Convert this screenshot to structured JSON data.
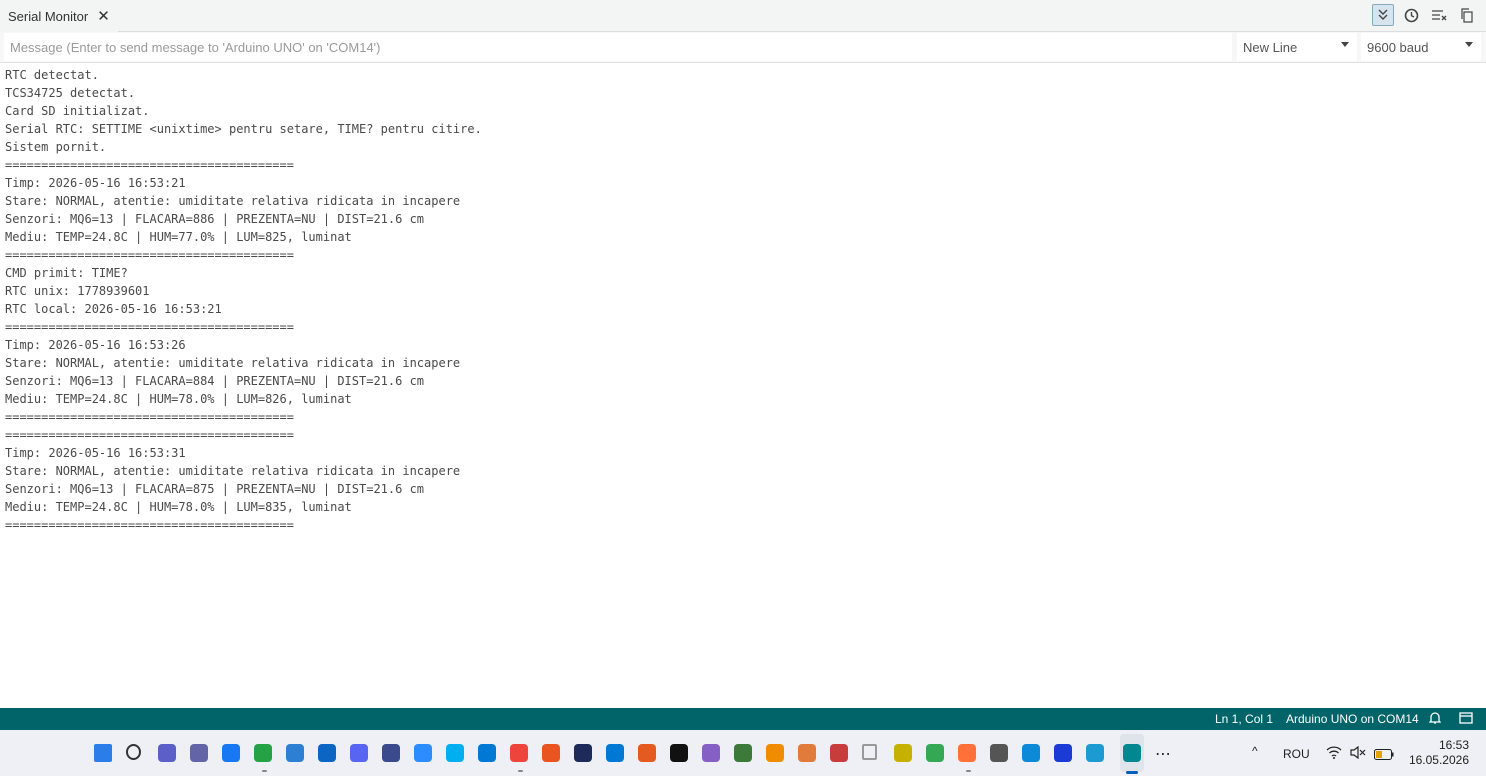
{
  "tab": {
    "title": "Serial Monitor",
    "close": "✕"
  },
  "toolbar": {
    "icons": [
      "autoscroll-icon",
      "timestamp-icon",
      "clear-output-icon",
      "copy-icon"
    ]
  },
  "message": {
    "placeholder": "Message (Enter to send message to 'Arduino UNO' on 'COM14')",
    "value": ""
  },
  "line_ending": {
    "selected": "New Line"
  },
  "baud_rate": {
    "selected": "9600 baud"
  },
  "output": {
    "lines": [
      "RTC detectat.",
      "TCS34725 detectat.",
      "Card SD initializat.",
      "Serial RTC: SETTIME <unixtime> pentru setare, TIME? pentru citire.",
      "Sistem pornit.",
      "========================================",
      "Timp: 2026-05-16 16:53:21",
      "Stare: NORMAL, atentie: umiditate relativa ridicata in incapere",
      "Senzori: MQ6=13 | FLACARA=886 | PREZENTA=NU | DIST=21.6 cm",
      "Mediu: TEMP=24.8C | HUM=77.0% | LUM=825, luminat",
      "========================================",
      "CMD primit: TIME?",
      "RTC unix: 1778939601",
      "RTC local: 2026-05-16 16:53:21",
      "========================================",
      "Timp: 2026-05-16 16:53:26",
      "Stare: NORMAL, atentie: umiditate relativa ridicata in incapere",
      "Senzori: MQ6=13 | FLACARA=884 | PREZENTA=NU | DIST=21.6 cm",
      "Mediu: TEMP=24.8C | HUM=78.0% | LUM=826, luminat",
      "========================================",
      "========================================",
      "Timp: 2026-05-16 16:53:31",
      "Stare: NORMAL, atentie: umiditate relativa ridicata in incapere",
      "Senzori: MQ6=13 | FLACARA=875 | PREZENTA=NU | DIST=21.6 cm",
      "Mediu: TEMP=24.8C | HUM=78.0% | LUM=835, luminat",
      "========================================"
    ]
  },
  "statusbar": {
    "position": "Ln 1, Col 1",
    "board": "Arduino UNO on COM14"
  },
  "taskbar": {
    "tray": {
      "language": "ROU",
      "more": "⋯",
      "chevron": "^"
    },
    "clock": {
      "time": "16:53",
      "date": "16.05.2026"
    }
  },
  "colors": {
    "statusbar": "#006468",
    "accent": "#005fb8",
    "taskbar": "#eef0f5"
  }
}
